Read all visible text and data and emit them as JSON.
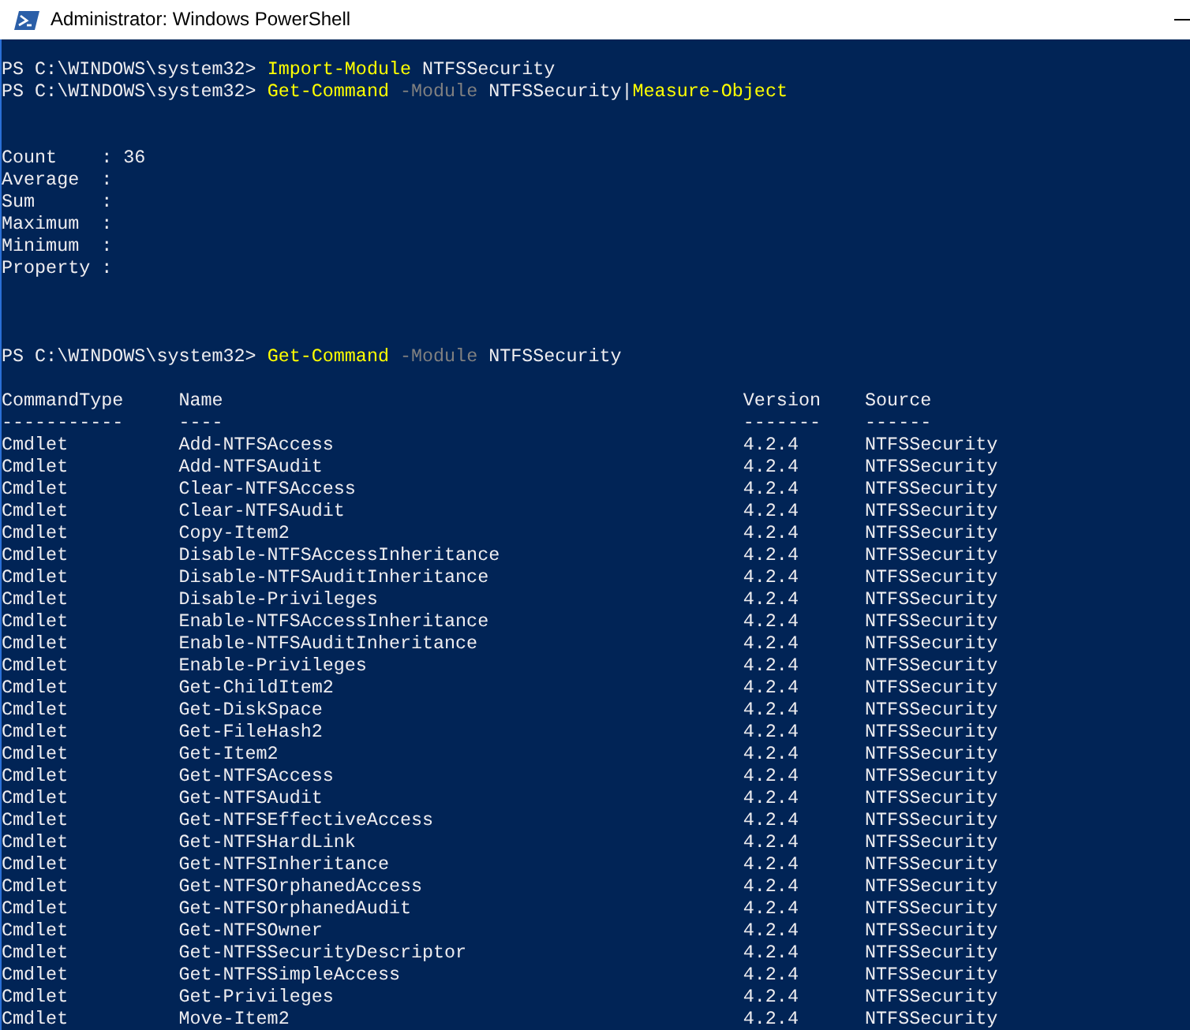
{
  "window": {
    "title": "Administrator: Windows PowerShell"
  },
  "console": {
    "lines": [
      {
        "kind": "prompt",
        "prompt": "PS C:\\WINDOWS\\system32>",
        "tokens": [
          {
            "kind": "command",
            "text": "Import-Module"
          },
          {
            "kind": "argument",
            "text": "NTFSSecurity"
          }
        ]
      },
      {
        "kind": "prompt",
        "prompt": "PS C:\\WINDOWS\\system32>",
        "tokens": [
          {
            "kind": "command",
            "text": "Get-Command"
          },
          {
            "kind": "parameter",
            "text": "-Module"
          },
          {
            "kind": "argument",
            "text": "NTFSSecurity"
          },
          {
            "kind": "pipe",
            "text": "|"
          },
          {
            "kind": "command",
            "text": "Measure-Object"
          }
        ]
      },
      {
        "kind": "blank"
      },
      {
        "kind": "blank"
      },
      {
        "kind": "output",
        "text": "Count    : 36"
      },
      {
        "kind": "output",
        "text": "Average  :"
      },
      {
        "kind": "output",
        "text": "Sum      :"
      },
      {
        "kind": "output",
        "text": "Maximum  :"
      },
      {
        "kind": "output",
        "text": "Minimum  :"
      },
      {
        "kind": "output",
        "text": "Property :"
      },
      {
        "kind": "blank"
      },
      {
        "kind": "blank"
      },
      {
        "kind": "blank"
      },
      {
        "kind": "prompt",
        "prompt": "PS C:\\WINDOWS\\system32>",
        "tokens": [
          {
            "kind": "command",
            "text": "Get-Command"
          },
          {
            "kind": "parameter",
            "text": "-Module"
          },
          {
            "kind": "argument",
            "text": "NTFSSecurity"
          }
        ]
      },
      {
        "kind": "blank"
      },
      {
        "kind": "table",
        "columns": [
          {
            "label": "CommandType",
            "underline": "-----------"
          },
          {
            "label": "Name",
            "underline": "----"
          },
          {
            "label": "Version",
            "underline": "-------"
          },
          {
            "label": "Source",
            "underline": "------"
          }
        ],
        "rows": [
          [
            "Cmdlet",
            "Add-NTFSAccess",
            "4.2.4",
            "NTFSSecurity"
          ],
          [
            "Cmdlet",
            "Add-NTFSAudit",
            "4.2.4",
            "NTFSSecurity"
          ],
          [
            "Cmdlet",
            "Clear-NTFSAccess",
            "4.2.4",
            "NTFSSecurity"
          ],
          [
            "Cmdlet",
            "Clear-NTFSAudit",
            "4.2.4",
            "NTFSSecurity"
          ],
          [
            "Cmdlet",
            "Copy-Item2",
            "4.2.4",
            "NTFSSecurity"
          ],
          [
            "Cmdlet",
            "Disable-NTFSAccessInheritance",
            "4.2.4",
            "NTFSSecurity"
          ],
          [
            "Cmdlet",
            "Disable-NTFSAuditInheritance",
            "4.2.4",
            "NTFSSecurity"
          ],
          [
            "Cmdlet",
            "Disable-Privileges",
            "4.2.4",
            "NTFSSecurity"
          ],
          [
            "Cmdlet",
            "Enable-NTFSAccessInheritance",
            "4.2.4",
            "NTFSSecurity"
          ],
          [
            "Cmdlet",
            "Enable-NTFSAuditInheritance",
            "4.2.4",
            "NTFSSecurity"
          ],
          [
            "Cmdlet",
            "Enable-Privileges",
            "4.2.4",
            "NTFSSecurity"
          ],
          [
            "Cmdlet",
            "Get-ChildItem2",
            "4.2.4",
            "NTFSSecurity"
          ],
          [
            "Cmdlet",
            "Get-DiskSpace",
            "4.2.4",
            "NTFSSecurity"
          ],
          [
            "Cmdlet",
            "Get-FileHash2",
            "4.2.4",
            "NTFSSecurity"
          ],
          [
            "Cmdlet",
            "Get-Item2",
            "4.2.4",
            "NTFSSecurity"
          ],
          [
            "Cmdlet",
            "Get-NTFSAccess",
            "4.2.4",
            "NTFSSecurity"
          ],
          [
            "Cmdlet",
            "Get-NTFSAudit",
            "4.2.4",
            "NTFSSecurity"
          ],
          [
            "Cmdlet",
            "Get-NTFSEffectiveAccess",
            "4.2.4",
            "NTFSSecurity"
          ],
          [
            "Cmdlet",
            "Get-NTFSHardLink",
            "4.2.4",
            "NTFSSecurity"
          ],
          [
            "Cmdlet",
            "Get-NTFSInheritance",
            "4.2.4",
            "NTFSSecurity"
          ],
          [
            "Cmdlet",
            "Get-NTFSOrphanedAccess",
            "4.2.4",
            "NTFSSecurity"
          ],
          [
            "Cmdlet",
            "Get-NTFSOrphanedAudit",
            "4.2.4",
            "NTFSSecurity"
          ],
          [
            "Cmdlet",
            "Get-NTFSOwner",
            "4.2.4",
            "NTFSSecurity"
          ],
          [
            "Cmdlet",
            "Get-NTFSSecurityDescriptor",
            "4.2.4",
            "NTFSSecurity"
          ],
          [
            "Cmdlet",
            "Get-NTFSSimpleAccess",
            "4.2.4",
            "NTFSSecurity"
          ],
          [
            "Cmdlet",
            "Get-Privileges",
            "4.2.4",
            "NTFSSecurity"
          ],
          [
            "Cmdlet",
            "Move-Item2",
            "4.2.4",
            "NTFSSecurity"
          ]
        ]
      }
    ]
  }
}
